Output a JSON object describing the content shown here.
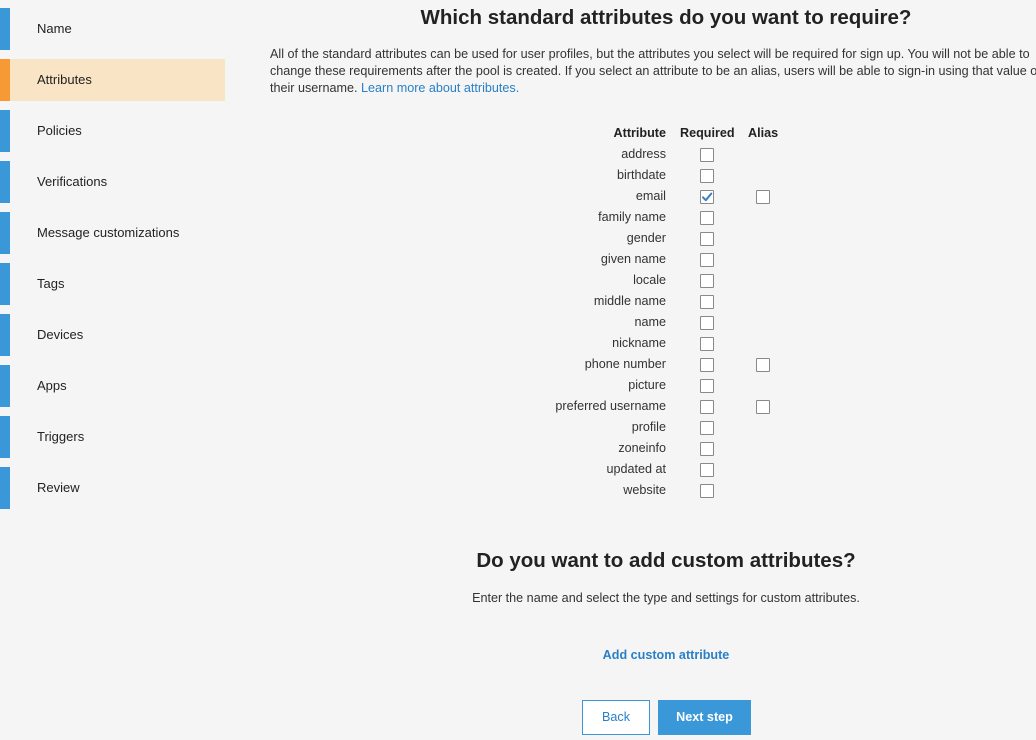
{
  "sidebar": {
    "items": [
      {
        "label": "Name",
        "active": false
      },
      {
        "label": "Attributes",
        "active": true
      },
      {
        "label": "Policies",
        "active": false
      },
      {
        "label": "Verifications",
        "active": false
      },
      {
        "label": "Message customizations",
        "active": false
      },
      {
        "label": "Tags",
        "active": false
      },
      {
        "label": "Devices",
        "active": false
      },
      {
        "label": "Apps",
        "active": false
      },
      {
        "label": "Triggers",
        "active": false
      },
      {
        "label": "Review",
        "active": false
      }
    ]
  },
  "standard": {
    "title": "Which standard attributes do you want to require?",
    "description_lines": [
      "All of the standard attributes can be used for user profiles, but the attributes you select will be required for sign up. You will not be able to",
      "change these requirements after the pool is created. If you select an attribute to be an alias, users will be able to sign-in using that value or",
      "their username. "
    ],
    "learn_more_link": "Learn more about attributes.",
    "table": {
      "headers": {
        "attribute": "Attribute",
        "required": "Required",
        "alias": "Alias"
      },
      "rows": [
        {
          "name": "address",
          "required": false,
          "alias": null
        },
        {
          "name": "birthdate",
          "required": false,
          "alias": null
        },
        {
          "name": "email",
          "required": true,
          "alias": false
        },
        {
          "name": "family name",
          "required": false,
          "alias": null
        },
        {
          "name": "gender",
          "required": false,
          "alias": null
        },
        {
          "name": "given name",
          "required": false,
          "alias": null
        },
        {
          "name": "locale",
          "required": false,
          "alias": null
        },
        {
          "name": "middle name",
          "required": false,
          "alias": null
        },
        {
          "name": "name",
          "required": false,
          "alias": null
        },
        {
          "name": "nickname",
          "required": false,
          "alias": null
        },
        {
          "name": "phone number",
          "required": false,
          "alias": false
        },
        {
          "name": "picture",
          "required": false,
          "alias": null
        },
        {
          "name": "preferred username",
          "required": false,
          "alias": false
        },
        {
          "name": "profile",
          "required": false,
          "alias": null
        },
        {
          "name": "zoneinfo",
          "required": false,
          "alias": null
        },
        {
          "name": "updated at",
          "required": false,
          "alias": null
        },
        {
          "name": "website",
          "required": false,
          "alias": null
        }
      ]
    }
  },
  "custom": {
    "title": "Do you want to add custom attributes?",
    "description": "Enter the name and select the type and settings for custom attributes.",
    "add_link": "Add custom attribute"
  },
  "buttons": {
    "back": "Back",
    "next": "Next step"
  },
  "colors": {
    "accent_blue": "#3a98d8",
    "link_blue": "#2a7fc6",
    "active_orange": "#f59a35",
    "active_bg": "#f9e4c6",
    "background": "#f4f5f4"
  }
}
